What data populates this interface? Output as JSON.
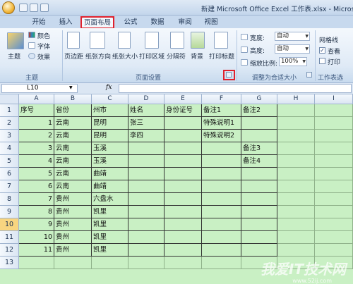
{
  "window": {
    "title": "新建 Microsoft Office Excel 工作表.xlsx - Microsoft E"
  },
  "tabs": [
    "开始",
    "插入",
    "页面布局",
    "公式",
    "数据",
    "审阅",
    "视图"
  ],
  "ribbon": {
    "theme_group": {
      "label": "主题",
      "theme": "主题",
      "colors": "颜色",
      "fonts": "字体",
      "effects": "效果"
    },
    "page_setup": {
      "label": "页面设置",
      "buttons": [
        "页边距",
        "纸张方向",
        "纸张大小",
        "打印区域",
        "分隔符",
        "背景",
        "打印标题"
      ]
    },
    "scale_to_fit": {
      "label": "调整为合适大小",
      "width_label": "宽度:",
      "width_value": "自动",
      "height_label": "高度:",
      "height_value": "自动",
      "scale_label": "缩放比例:",
      "scale_value": "100%"
    },
    "sheet_options": {
      "label": "工作表选",
      "gridlines": "网格线",
      "view": "查看",
      "print": "打印"
    }
  },
  "formula_bar": {
    "name_box": "L10",
    "fx": "fx",
    "value": ""
  },
  "columns": [
    "A",
    "B",
    "C",
    "D",
    "E",
    "F",
    "G",
    "H",
    "I"
  ],
  "rows": [
    "1",
    "2",
    "3",
    "4",
    "5",
    "6",
    "7",
    "8",
    "9",
    "10",
    "11",
    "12",
    "13"
  ],
  "cells": {
    "r1": [
      "序号",
      "省份",
      "州市",
      "姓名",
      "身份证号",
      "备注1",
      "备注2"
    ],
    "r2": [
      "1",
      "云南",
      "昆明",
      "张三",
      "",
      "特殊说明1",
      ""
    ],
    "r3": [
      "2",
      "云南",
      "昆明",
      "李四",
      "",
      "特殊说明2",
      ""
    ],
    "r4": [
      "3",
      "云南",
      "玉溪",
      "",
      "",
      "",
      "备注3"
    ],
    "r5": [
      "4",
      "云南",
      "玉溪",
      "",
      "",
      "",
      "备注4"
    ],
    "r6": [
      "5",
      "云南",
      "曲靖",
      "",
      "",
      "",
      ""
    ],
    "r7": [
      "6",
      "云南",
      "曲靖",
      "",
      "",
      "",
      ""
    ],
    "r8": [
      "7",
      "贵州",
      "六盘水",
      "",
      "",
      "",
      ""
    ],
    "r9": [
      "8",
      "贵州",
      "凯里",
      "",
      "",
      "",
      ""
    ],
    "r10": [
      "9",
      "贵州",
      "凯里",
      "",
      "",
      "",
      ""
    ],
    "r11": [
      "10",
      "贵州",
      "凯里",
      "",
      "",
      "",
      ""
    ],
    "r12": [
      "11",
      "贵州",
      "凯里",
      "",
      "",
      "",
      ""
    ]
  },
  "watermark": {
    "text": "我爱IT技术网",
    "sub": "www.52ij.com"
  },
  "colors": {
    "highlight": "#e0212d",
    "sheet_bg": "#c9f0c4"
  }
}
